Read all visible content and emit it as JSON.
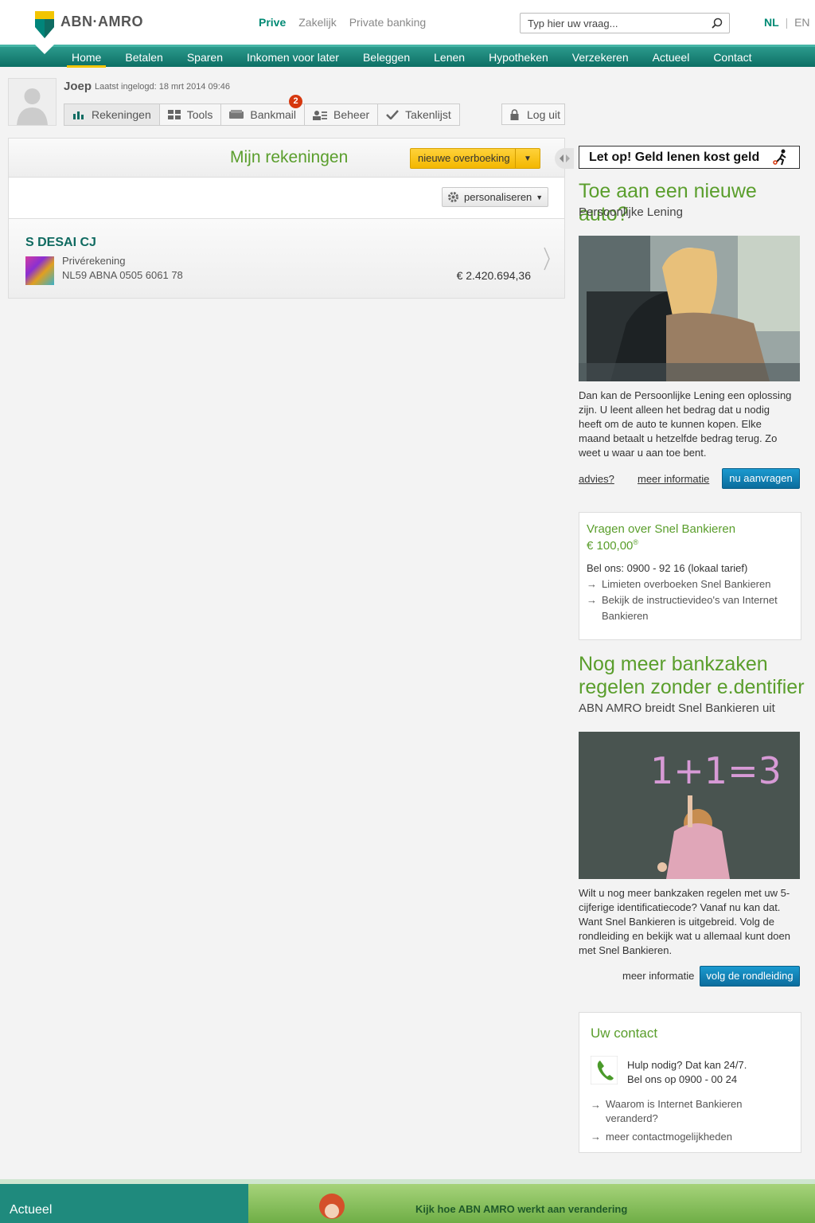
{
  "brand": {
    "name": "ABN·AMRO"
  },
  "segments": [
    "Prive",
    "Zakelijk",
    "Private banking"
  ],
  "search": {
    "placeholder": "Typ hier uw vraag..."
  },
  "languages": {
    "active": "NL",
    "sep": "|",
    "other": "EN"
  },
  "nav": [
    "Home",
    "Betalen",
    "Sparen",
    "Inkomen voor later",
    "Beleggen",
    "Lenen",
    "Hypotheken",
    "Verzekeren",
    "Actueel",
    "Contact"
  ],
  "user": {
    "name": "Joep",
    "last_login": "Laatst ingelogd: 18 mrt 2014 09:46"
  },
  "tabs": [
    {
      "label": "Rekeningen",
      "icon": "bar-chart-icon"
    },
    {
      "label": "Tools",
      "icon": "grid-icon"
    },
    {
      "label": "Bankmail",
      "icon": "mail-icon",
      "badge": "2"
    },
    {
      "label": "Beheer",
      "icon": "users-icon"
    },
    {
      "label": "Takenlijst",
      "icon": "check-icon"
    }
  ],
  "logout": "Log uit",
  "accounts_panel": {
    "title": "Mijn rekeningen",
    "transfer_button": "nieuwe overboeking",
    "personalize_button": "personaliseren",
    "account": {
      "holder": "S DESAI CJ",
      "type": "Privérekening",
      "iban": "NL59 ABNA 0505 6061 78",
      "balance": "€ 2.420.694,36"
    }
  },
  "sidebar": {
    "warning": "Let op! Geld lenen kost geld",
    "promo1": {
      "title": "Toe aan een nieuwe auto?",
      "subtitle": "Persoonlijke Lening",
      "body": "Dan kan de Persoonlijke Lening een oplossing zijn. U leent alleen het bedrag dat u nodig heeft om de auto te kunnen kopen. Elke maand betaalt u hetzelfde bedrag terug. Zo weet u waar u aan toe bent.",
      "link_advice": "advies?",
      "link_more": "meer informatie",
      "button": "nu aanvragen"
    },
    "help_box": {
      "title": "Vragen over Snel Bankieren",
      "amount": "€ 100,00",
      "amount_sup": "®",
      "phone": "Bel ons: 0900 - 92 16 (lokaal tarief)",
      "link1": "Limieten overboeken Snel Bankieren",
      "link2": "Bekijk de instructievideo's van Internet Bankieren"
    },
    "promo2": {
      "title": "Nog meer bankzaken regelen zonder e.dentifier",
      "subtitle": "ABN AMRO breidt Snel Bankieren uit",
      "body": "Wilt u nog meer bankzaken regelen met uw 5-cijferige identificatiecode? Vanaf nu kan dat. Want Snel Bankieren is uitgebreid. Volg de rondleiding en bekijk wat u allemaal kunt doen met Snel Bankieren.",
      "link_more": "meer informatie",
      "button": "volg de rondleiding",
      "chalk_text": "1+1=3"
    },
    "contact": {
      "title": "Uw contact",
      "line1": "Hulp nodig? Dat kan 24/7.",
      "line2": "Bel ons op 0900 - 00 24",
      "link1": "Waarom is Internet Bankieren veranderd?",
      "link2": "meer contactmogelijkheden"
    }
  },
  "footer": {
    "left": "Actueel",
    "right": "Kijk hoe ABN AMRO werkt aan verandering"
  }
}
